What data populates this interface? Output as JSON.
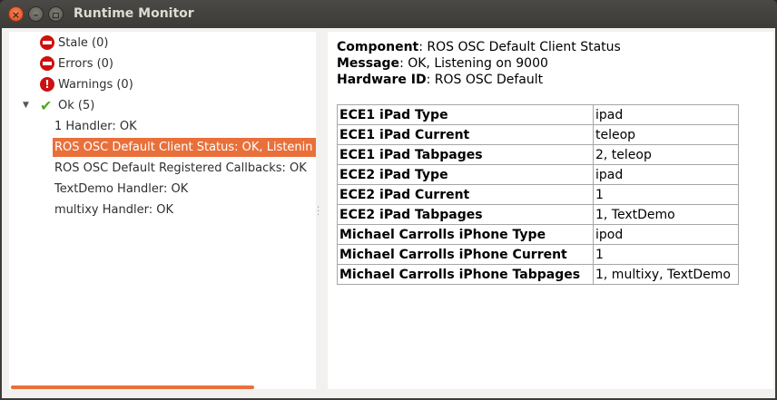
{
  "window": {
    "title": "Runtime Monitor"
  },
  "tree": {
    "stale": "Stale (0)",
    "errors": "Errors (0)",
    "warnings": "Warnings (0)",
    "ok": "Ok (5)",
    "items": [
      "1 Handler: OK",
      "ROS OSC Default Client Status: OK, Listenin",
      "ROS OSC Default Registered Callbacks: OK",
      "TextDemo Handler: OK",
      "multixy Handler: OK"
    ]
  },
  "detail": {
    "component_label": "Component",
    "component_value": ": ROS OSC Default Client Status",
    "message_label": "Message",
    "message_value": ": OK, Listening on 9000",
    "hardware_label": "Hardware ID",
    "hardware_value": ": ROS OSC Default",
    "rows": [
      {
        "k": "ECE1 iPad Type",
        "v": "ipad"
      },
      {
        "k": "ECE1 iPad Current",
        "v": "teleop"
      },
      {
        "k": "ECE1 iPad Tabpages",
        "v": "2, teleop"
      },
      {
        "k": "ECE2 iPad Type",
        "v": "ipad"
      },
      {
        "k": "ECE2 iPad Current",
        "v": "1"
      },
      {
        "k": "ECE2 iPad Tabpages",
        "v": "1, TextDemo"
      },
      {
        "k": "Michael Carrolls iPhone Type",
        "v": "ipod"
      },
      {
        "k": "Michael Carrolls iPhone Current",
        "v": "1"
      },
      {
        "k": "Michael Carrolls iPhone Tabpages",
        "v": "1, multixy, TextDemo"
      }
    ]
  },
  "colors": {
    "accent": "#e9703a",
    "error": "#cc1111",
    "ok": "#4caa20"
  }
}
